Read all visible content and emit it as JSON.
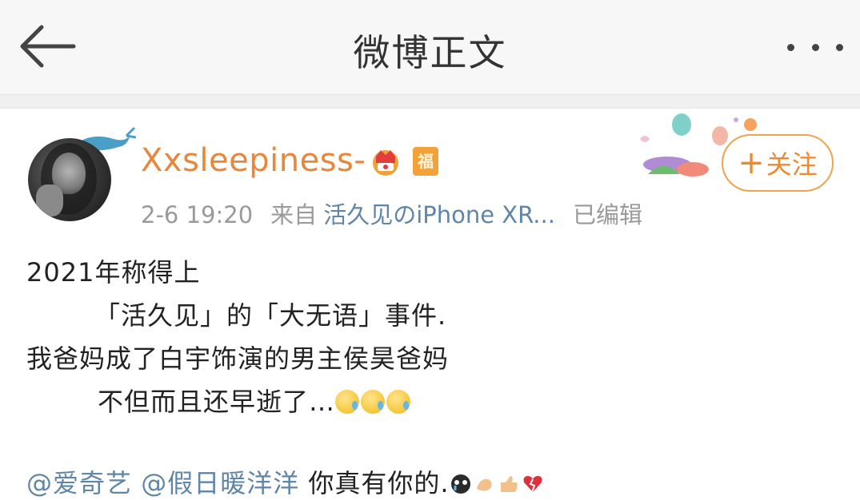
{
  "nav": {
    "title": "微博正文"
  },
  "author": {
    "name": "Xxsleepiness-",
    "badge_label": "福",
    "timestamp": "2-6 19:20",
    "source_prefix": "来自",
    "source": "活久见のiPhone XR...",
    "edited": "已编辑"
  },
  "follow": {
    "label": "关注",
    "plus": "+"
  },
  "post": {
    "lines": [
      "2021年称得上",
      "「活久见」的「大无语」事件.",
      "我爸妈成了白宇饰演的男主侯昊爸妈",
      "不但而且还早逝了…"
    ],
    "mention_1": "@爱奇艺",
    "mention_2": "@假日暖洋洋",
    "closing": " 你真有你的."
  },
  "colors": {
    "username": "#e8863a",
    "link": "#5f86a8",
    "follow_border": "#f0a24d"
  },
  "icons": [
    "back-arrow-icon",
    "more-icon",
    "crown-badge-icon",
    "fu-badge-icon",
    "sweat-emoji-icon",
    "thumbs-up-icon",
    "broken-heart-icon"
  ]
}
